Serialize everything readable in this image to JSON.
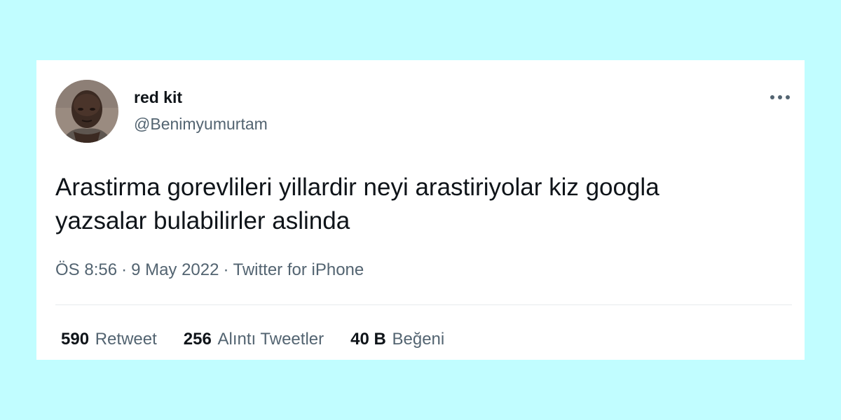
{
  "colors": {
    "background": "#c1fdff",
    "card": "#ffffff",
    "text_primary": "#0f1419",
    "text_secondary": "#536471"
  },
  "tweet": {
    "author": {
      "display_name": "red kit",
      "handle": "@Benimyumurtam",
      "avatar_icon": "profile-photo"
    },
    "more_icon": "more-horizontal-icon",
    "text_line1": "Arastirma gorevlileri yillardir neyi arastiriyolar kiz googla",
    "text_line2": "yazsalar bulabilirler aslinda",
    "time": "ÖS 8:56",
    "separator": "·",
    "date": "9 May 2022",
    "source": "Twitter for iPhone",
    "stats": {
      "retweets_count": "590",
      "retweets_label": "Retweet",
      "quotes_count": "256",
      "quotes_label": "Alıntı Tweetler",
      "likes_count": "40 B",
      "likes_label": "Beğeni"
    }
  }
}
